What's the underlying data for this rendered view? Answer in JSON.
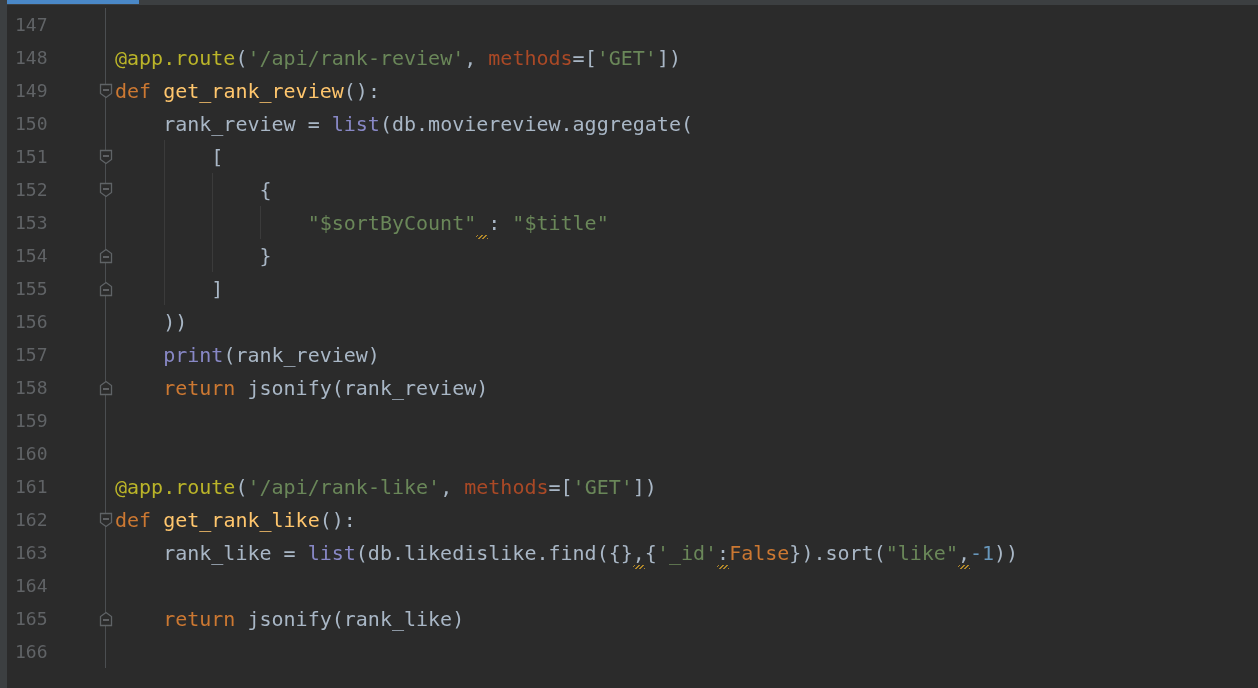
{
  "editor": {
    "tabs": [
      {
        "selected": true
      }
    ],
    "lines": [
      {
        "number": "147"
      },
      {
        "number": "148",
        "tokens": [
          {
            "kind": "decorator",
            "text": "@app.route"
          },
          {
            "kind": "plain",
            "text": "("
          },
          {
            "kind": "string",
            "text": "'/api/rank-review'"
          },
          {
            "kind": "plain",
            "text": ", "
          },
          {
            "kind": "param",
            "text": "methods"
          },
          {
            "kind": "plain",
            "text": "=["
          },
          {
            "kind": "string",
            "text": "'GET'"
          },
          {
            "kind": "plain",
            "text": "])"
          }
        ]
      },
      {
        "number": "149",
        "fold_start": true,
        "tokens": [
          {
            "kind": "keyword",
            "text": "def "
          },
          {
            "kind": "function",
            "text": "get_rank_review"
          },
          {
            "kind": "plain",
            "text": "():"
          }
        ]
      },
      {
        "number": "150",
        "tokens": [
          {
            "kind": "plain",
            "text": "    rank_review = "
          },
          {
            "kind": "builtin",
            "text": "list"
          },
          {
            "kind": "plain",
            "text": "(db.moviereview.aggregate("
          }
        ]
      },
      {
        "number": "151",
        "fold_start": true,
        "tokens": [
          {
            "kind": "plain",
            "text": "        ["
          }
        ]
      },
      {
        "number": "152",
        "fold_start": true,
        "tokens": [
          {
            "kind": "plain",
            "text": "            {"
          }
        ]
      },
      {
        "number": "153",
        "tokens": [
          {
            "kind": "string",
            "text": "                \"$sortByCount\""
          },
          {
            "kind": "plain",
            "text": " : ",
            "warning": true
          },
          {
            "kind": "string",
            "text": "\"$title\""
          }
        ]
      },
      {
        "number": "154",
        "fold_end": true,
        "tokens": [
          {
            "kind": "plain",
            "text": "            }"
          }
        ]
      },
      {
        "number": "155",
        "fold_end": true,
        "tokens": [
          {
            "kind": "plain",
            "text": "        ]"
          }
        ]
      },
      {
        "number": "156",
        "tokens": [
          {
            "kind": "plain",
            "text": "    ))"
          }
        ]
      },
      {
        "number": "157",
        "tokens": [
          {
            "kind": "builtin",
            "text": "    print"
          },
          {
            "kind": "plain",
            "text": "(rank_review)"
          }
        ]
      },
      {
        "number": "158",
        "fold_end": true,
        "tokens": [
          {
            "kind": "keyword",
            "text": "    return "
          },
          {
            "kind": "plain",
            "text": "jsonify(rank_review)"
          }
        ]
      },
      {
        "number": "159"
      },
      {
        "number": "160"
      },
      {
        "number": "161",
        "tokens": [
          {
            "kind": "decorator",
            "text": "@app.route"
          },
          {
            "kind": "plain",
            "text": "("
          },
          {
            "kind": "string",
            "text": "'/api/rank-like'"
          },
          {
            "kind": "plain",
            "text": ", "
          },
          {
            "kind": "param",
            "text": "methods"
          },
          {
            "kind": "plain",
            "text": "=["
          },
          {
            "kind": "string",
            "text": "'GET'"
          },
          {
            "kind": "plain",
            "text": "])"
          }
        ]
      },
      {
        "number": "162",
        "fold_start": true,
        "tokens": [
          {
            "kind": "keyword",
            "text": "def "
          },
          {
            "kind": "function",
            "text": "get_rank_like"
          },
          {
            "kind": "plain",
            "text": "():"
          }
        ]
      },
      {
        "number": "163",
        "tokens": [
          {
            "kind": "plain",
            "text": "    rank_like = "
          },
          {
            "kind": "builtin",
            "text": "list"
          },
          {
            "kind": "plain",
            "text": "(db.likedislike.find({}"
          },
          {
            "kind": "plain",
            "text": ",",
            "warning": true
          },
          {
            "kind": "plain",
            "text": "{"
          },
          {
            "kind": "string",
            "text": "'_id'"
          },
          {
            "kind": "plain",
            "text": ":",
            "warning": true
          },
          {
            "kind": "keyword",
            "text": "False"
          },
          {
            "kind": "plain",
            "text": "}).sort("
          },
          {
            "kind": "string",
            "text": "\"like\""
          },
          {
            "kind": "plain",
            "text": ",",
            "warning": true
          },
          {
            "kind": "number",
            "text": "-1"
          },
          {
            "kind": "plain",
            "text": "))"
          }
        ]
      },
      {
        "number": "164"
      },
      {
        "number": "165",
        "fold_end": true,
        "tokens": [
          {
            "kind": "keyword",
            "text": "    return "
          },
          {
            "kind": "plain",
            "text": "jsonify(rank_like)"
          }
        ]
      },
      {
        "number": "166"
      }
    ]
  }
}
